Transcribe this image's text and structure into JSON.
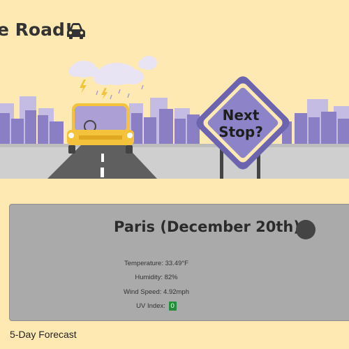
{
  "header": {
    "title_visible": "e Road!",
    "car_icon": "car-icon"
  },
  "hero": {
    "sign_text_line1": "Next",
    "sign_text_line2": "Stop?"
  },
  "weather": {
    "city_title": "Paris (December 20th)",
    "icon": "weather-icon",
    "temperature_label": "Temperature: ",
    "temperature_value": "33.49°F",
    "humidity_label": "Humidity: ",
    "humidity_value": "82%",
    "wind_label": "Wind Speed: ",
    "wind_value": "4.92mph",
    "uv_label": "UV Index: ",
    "uv_value": "0",
    "uv_color": "#1f8f3a"
  },
  "forecast": {
    "heading": "5-Day Forecast"
  }
}
